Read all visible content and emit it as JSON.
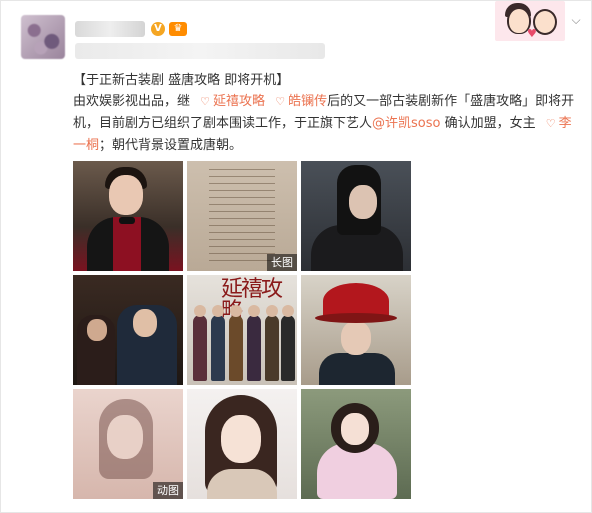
{
  "header": {
    "username": "",
    "v_badge": "V",
    "vip_badge": "♛",
    "meta": ""
  },
  "post": {
    "title": "【于正新古装剧 盛唐攻略 即将开机】",
    "text_1": "由欢娱影视出品，继",
    "topic_1": "延禧攻略",
    "topic_2": "皓镧传",
    "text_2": "后的又一部古装剧新作「盛唐攻略」即将开机，目前剧方已组织了剧本围读工作，于正旗下艺人",
    "mention": "@许凯soso",
    "text_3": " 确认加盟，女主",
    "topic_3": "李一桐",
    "text_4": "；朝代背景设置成唐朝。"
  },
  "images": [
    {
      "name": "photo-man-red-shirt"
    },
    {
      "name": "photo-document",
      "tag": "长图"
    },
    {
      "name": "photo-man-long-hair"
    },
    {
      "name": "photo-drama-scene"
    },
    {
      "name": "photo-yanxi-poster",
      "poster_text": "延禧攻略"
    },
    {
      "name": "photo-man-red-hat"
    },
    {
      "name": "photo-woman-soft",
      "tag": "动图"
    },
    {
      "name": "photo-woman-portrait"
    },
    {
      "name": "photo-woman-pink-dress"
    }
  ],
  "icons": {
    "topic_icon": "♡",
    "chevron": "⌵"
  },
  "colors": {
    "link": "#eb7350",
    "text": "#333333"
  }
}
